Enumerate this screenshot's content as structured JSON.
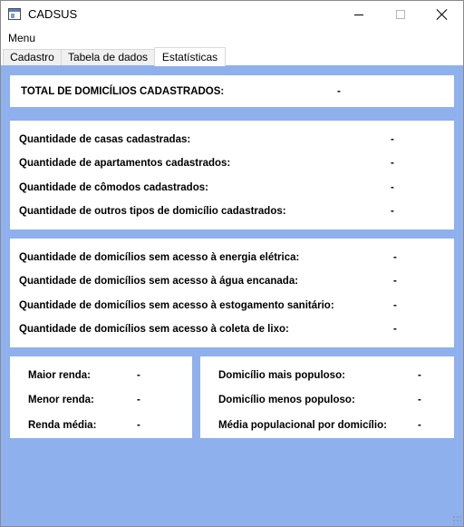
{
  "window": {
    "title": "CADSUS",
    "icon": "app-window-icon"
  },
  "menu": {
    "label": "Menu"
  },
  "tabs": [
    {
      "label": "Cadastro",
      "selected": false
    },
    {
      "label": "Tabela de dados",
      "selected": false
    },
    {
      "label": "Estatísticas",
      "selected": true
    }
  ],
  "total": {
    "label": "TOTAL DE DOMICÍLIOS CADASTRADOS:",
    "value": "-"
  },
  "tipos": [
    {
      "label": "Quantidade de casas cadastradas:",
      "value": "-"
    },
    {
      "label": "Quantidade de apartamentos cadastrados:",
      "value": "-"
    },
    {
      "label": "Quantidade de cômodos cadastrados:",
      "value": "-"
    },
    {
      "label": "Quantidade de outros tipos de domicílio cadastrados:",
      "value": "-"
    }
  ],
  "acesso": [
    {
      "label": "Quantidade de domicílios sem acesso à energia elétrica:",
      "value": "-"
    },
    {
      "label": "Quantidade de domicílios sem acesso à água encanada:",
      "value": "-"
    },
    {
      "label": "Quantidade de domicílios sem acesso à estogamento sanitário:",
      "value": "-"
    },
    {
      "label": "Quantidade de domicílios sem acesso à coleta de lixo:",
      "value": "-"
    }
  ],
  "renda": [
    {
      "label": "Maior renda:",
      "value": "-"
    },
    {
      "label": "Menor renda:",
      "value": "-"
    },
    {
      "label": "Renda média:",
      "value": "-"
    }
  ],
  "populacao": [
    {
      "label": "Domicílio mais populoso:",
      "value": "-"
    },
    {
      "label": "Domicílio menos populoso:",
      "value": "-"
    },
    {
      "label": "Média populacional por domicílio:",
      "value": "-"
    }
  ],
  "colors": {
    "content_background": "#8eb0ed",
    "panel_background": "#ffffff"
  }
}
